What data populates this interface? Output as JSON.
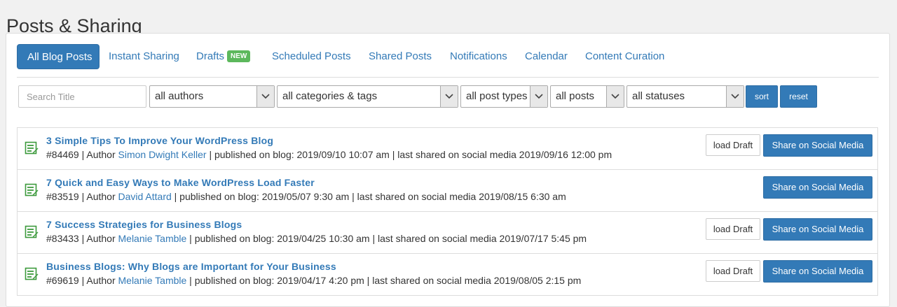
{
  "page": {
    "title": "Posts & Sharing"
  },
  "tabs": [
    {
      "label": "All Blog Posts",
      "active": true
    },
    {
      "label": "Instant Sharing"
    },
    {
      "label": "Drafts",
      "badge": "NEW"
    },
    {
      "label": "Scheduled Posts"
    },
    {
      "label": "Shared Posts"
    },
    {
      "label": "Notifications"
    },
    {
      "label": "Calendar"
    },
    {
      "label": "Content Curation"
    }
  ],
  "filters": {
    "search_placeholder": "Search Title",
    "authors": "all authors",
    "categories": "all categories & tags",
    "post_types": "all post types",
    "posts": "all posts",
    "statuses": "all statuses",
    "sort_label": "sort",
    "reset_label": "reset"
  },
  "posts": [
    {
      "title": "3 Simple Tips To Improve Your WordPress Blog",
      "id": "#84469",
      "author_prefix": " | Author ",
      "author": "Simon Dwight Keller",
      "details": " | published on blog: 2019/09/10 10:07 am | last shared on social media 2019/09/16 12:00 pm",
      "load_draft": "load Draft",
      "share": "Share on Social Media"
    },
    {
      "title": "7 Quick and Easy Ways to Make WordPress Load Faster",
      "id": "#83519",
      "author_prefix": " | Author ",
      "author": "David Attard",
      "details": " | published on blog: 2019/05/07 9:30 am | last shared on social media 2019/08/15 6:30 am",
      "load_draft": "",
      "share": "Share on Social Media"
    },
    {
      "title": "7 Success Strategies for Business Blogs",
      "id": "#83433",
      "author_prefix": " | Author ",
      "author": "Melanie Tamble",
      "details": " | published on blog: 2019/04/25 10:30 am | last shared on social media 2019/07/17 5:45 pm",
      "load_draft": "load Draft",
      "share": "Share on Social Media"
    },
    {
      "title": "Business Blogs: Why Blogs are Important for Your Business",
      "id": "#69619",
      "author_prefix": " | Author ",
      "author": "Melanie Tamble",
      "details": " | published on blog: 2019/04/17 4:20 pm | last shared on social media 2019/08/05 2:15 pm",
      "load_draft": "load Draft",
      "share": "Share on Social Media"
    }
  ],
  "colors": {
    "accent": "#337ab7",
    "badge": "#5cb85c",
    "icon": "#3c9a3c"
  },
  "icons": {
    "post": "post-edit-icon",
    "dropdown": "chevron-down-icon"
  }
}
